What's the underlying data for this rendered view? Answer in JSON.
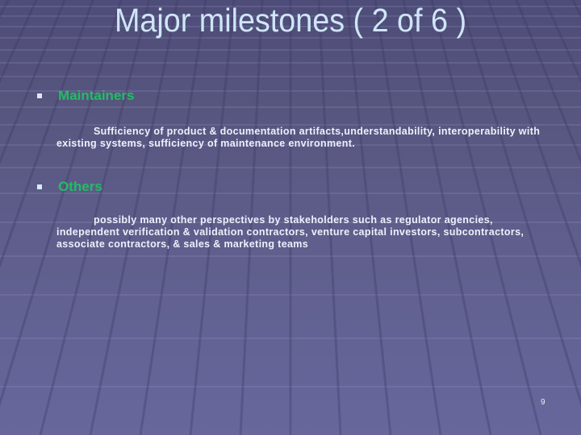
{
  "slide": {
    "title": "Major milestones ( 2 of 6 )",
    "bullets": [
      {
        "icon": "square-bullet-icon",
        "heading": "Maintainers",
        "text": "Sufficiency of product & documentation artifacts,understandability, interoperability with existing systems, sufficiency of maintenance environment."
      },
      {
        "icon": "square-bullet-icon",
        "heading": "Others",
        "text": "possibly many other perspectives by stakeholders such as regulator agencies, independent verification & validation contractors, venture capital investors, subcontractors, associate contractors, & sales & marketing teams"
      }
    ],
    "page_number": "9"
  },
  "colors": {
    "title": "#cfe6f7",
    "heading": "#1fbf62",
    "body_text": "#eef0fb",
    "bullet_marker": "#d9ecfb"
  }
}
